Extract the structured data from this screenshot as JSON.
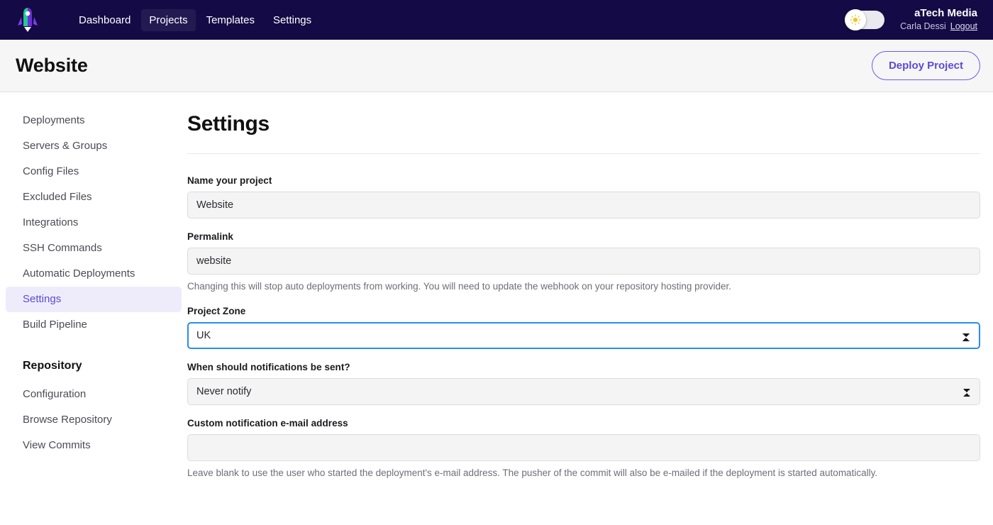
{
  "topnav": {
    "logo_name": "rocket-logo",
    "links": [
      {
        "label": "Dashboard",
        "active": false
      },
      {
        "label": "Projects",
        "active": true
      },
      {
        "label": "Templates",
        "active": false
      },
      {
        "label": "Settings",
        "active": false
      }
    ],
    "theme_toggle": {
      "icon": "sun-icon",
      "state": "light"
    },
    "account": {
      "org": "aTech Media",
      "user": "Carla Dessi",
      "logout_label": "Logout"
    }
  },
  "page_header": {
    "title": "Website",
    "deploy_label": "Deploy Project"
  },
  "sidebar": {
    "items": [
      {
        "label": "Deployments",
        "active": false
      },
      {
        "label": "Servers & Groups",
        "active": false
      },
      {
        "label": "Config Files",
        "active": false
      },
      {
        "label": "Excluded Files",
        "active": false
      },
      {
        "label": "Integrations",
        "active": false
      },
      {
        "label": "SSH Commands",
        "active": false
      },
      {
        "label": "Automatic Deployments",
        "active": false
      },
      {
        "label": "Settings",
        "active": true
      },
      {
        "label": "Build Pipeline",
        "active": false
      }
    ],
    "repository_heading": "Repository",
    "repository_items": [
      {
        "label": "Configuration"
      },
      {
        "label": "Browse Repository"
      },
      {
        "label": "View Commits"
      }
    ]
  },
  "main": {
    "title": "Settings",
    "fields": {
      "project_name": {
        "label": "Name your project",
        "value": "Website",
        "placeholder": ""
      },
      "permalink": {
        "label": "Permalink",
        "value": "website",
        "placeholder": "",
        "help": "Changing this will stop auto deployments from working. You will need to update the webhook on your repository hosting provider."
      },
      "project_zone": {
        "label": "Project Zone",
        "value": "UK",
        "focused": true
      },
      "notifications": {
        "label": "When should notifications be sent?",
        "value": "Never notify",
        "focused": false
      },
      "custom_email": {
        "label": "Custom notification e-mail address",
        "value": "",
        "placeholder": "",
        "help": "Leave blank to use the user who started the deployment's e-mail address. The pusher of the commit will also be e-mailed if the deployment is started automatically."
      }
    }
  },
  "colors": {
    "nav_bg": "#140b46",
    "accent_purple": "#5b4bd6",
    "focus_blue": "#2b8cf0",
    "active_side_bg": "#eeecfb"
  }
}
